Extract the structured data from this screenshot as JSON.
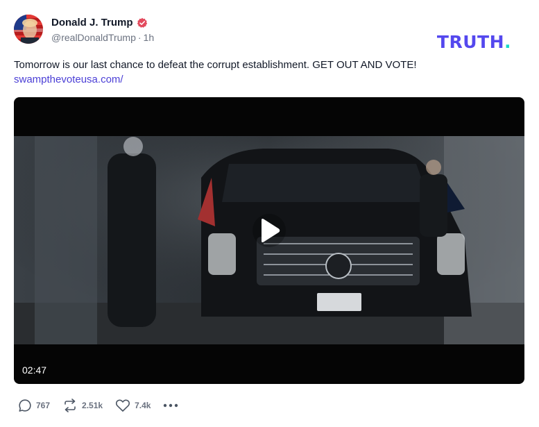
{
  "post": {
    "author": {
      "display_name": "Donald J. Trump",
      "handle": "@realDonaldTrump",
      "time": "1h",
      "verified": true,
      "avatar_icon": "profile-photo"
    },
    "brand": {
      "name": "TRUTH",
      "suffix": ".",
      "color": "#5448ee",
      "accent": "#17d9c8"
    },
    "text": "Tomorrow is our last chance to defeat the corrupt establishment. GET OUT AND VOTE!",
    "link": "swampthevoteusa.com/",
    "link_color": "#4b3fd6",
    "video": {
      "duration": "02:47",
      "play_icon": "play-icon"
    },
    "actions": {
      "replies": "767",
      "retruths": "2.51k",
      "likes": "7.4k",
      "reply_icon": "comment-icon",
      "retruth_icon": "repost-icon",
      "like_icon": "heart-icon",
      "more_icon": "more-icon"
    }
  },
  "colors": {
    "verified_badge": "#e34a5d",
    "text": "#111827",
    "muted": "#6b7280"
  }
}
